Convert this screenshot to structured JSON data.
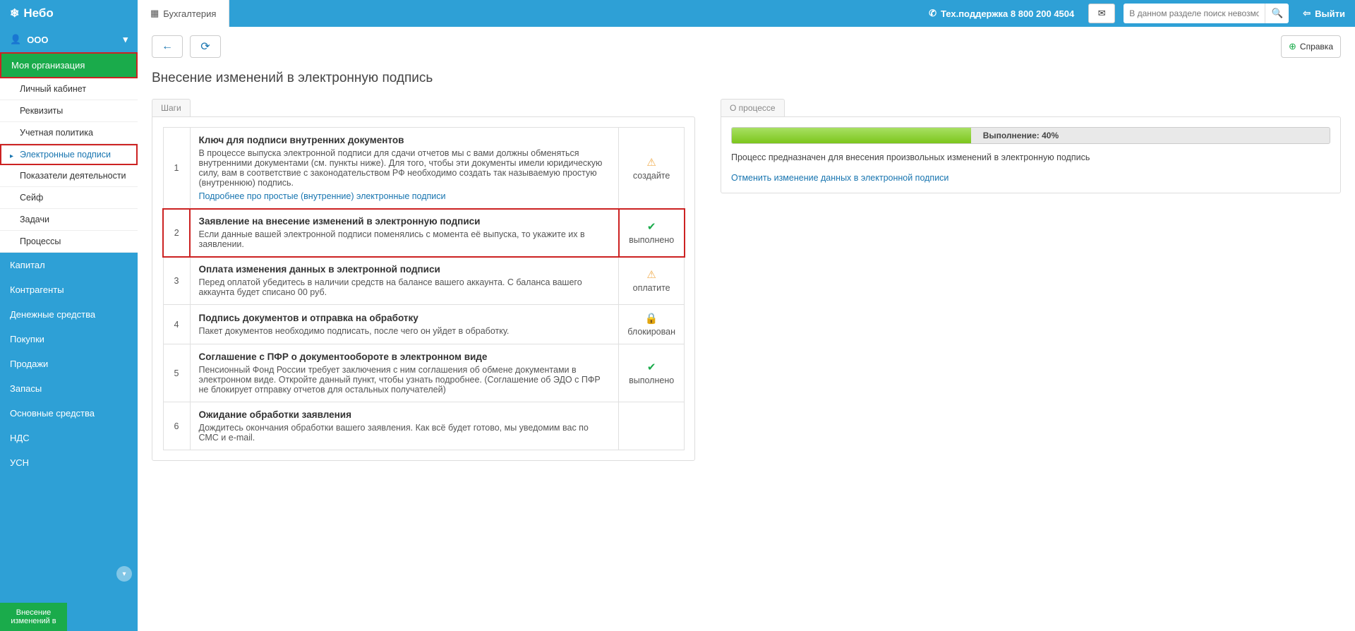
{
  "header": {
    "logo": "Небо",
    "tab": "Бухгалтерия",
    "support_label": "Тех.поддержка 8 800 200 4504",
    "search_placeholder": "В данном разделе поиск невозможен",
    "logout": "Выйти"
  },
  "sidebar": {
    "org": "ООО",
    "section_active": "Моя организация",
    "sub_items": [
      "Личный кабинет",
      "Реквизиты",
      "Учетная политика",
      "Электронные подписи",
      "Показатели деятельности",
      "Сейф",
      "Задачи",
      "Процессы"
    ],
    "main_items": [
      "Капитал",
      "Контрагенты",
      "Денежные средства",
      "Покупки",
      "Продажи",
      "Запасы",
      "Основные средства",
      "НДС",
      "УСН"
    ],
    "bottom_tab": "Внесение изменений в"
  },
  "toolbar": {
    "help": "Справка"
  },
  "page": {
    "title": "Внесение изменений в электронную подпись",
    "steps_tab": "Шаги",
    "process_tab": "О процессе"
  },
  "steps": [
    {
      "num": "1",
      "title": "Ключ для подписи внутренних документов",
      "desc": "В процессе выпуска электронной подписи для сдачи отчетов мы с вами должны обменяться внутренними документами (см. пункты ниже). Для того, чтобы эти документы имели юридическую силу, вам в соответствие с законодательством РФ необходимо создать так называемую простую (внутреннюю) подпись.",
      "link": "Подробнее про простые (внутренние) электронные подписи",
      "status_label": "создайте",
      "status_icon": "warning"
    },
    {
      "num": "2",
      "title": "Заявление на внесение изменений в электронную подписи",
      "desc": "Если данные вашей электронной подписи поменялись с момента её выпуска, то укажите их в заявлении.",
      "status_label": "выполнено",
      "status_icon": "check",
      "highlight": true
    },
    {
      "num": "3",
      "title": "Оплата изменения данных в электронной подписи",
      "desc": "Перед оплатой убедитесь в наличии средств на балансе вашего аккаунта. С баланса вашего аккаунта будет списано  00 руб.",
      "status_label": "оплатите",
      "status_icon": "warning"
    },
    {
      "num": "4",
      "title": "Подпись документов и отправка на обработку",
      "desc": "Пакет документов необходимо подписать, после чего он уйдет в обработку.",
      "status_label": "блокирован",
      "status_icon": "lock"
    },
    {
      "num": "5",
      "title": "Соглашение с ПФР о документообороте в электронном виде",
      "desc": "Пенсионный Фонд России требует заключения с ним соглашения об обмене документами в электронном виде. Откройте данный пункт, чтобы узнать подробнее. (Соглашение об ЭДО с ПФР не блокирует отправку отчетов для остальных получателей)",
      "status_label": "выполнено",
      "status_icon": "check"
    },
    {
      "num": "6",
      "title": "Ожидание обработки заявления",
      "desc": "Дождитесь окончания обработки вашего заявления. Как всё будет готово, мы уведомим вас по СМС и e-mail."
    }
  ],
  "process": {
    "progress_pct": 40,
    "progress_text": "Выполнение: 40%",
    "desc": "Процесс предназначен для внесения произвольных изменений в электронную подпись",
    "cancel_link": "Отменить изменение данных в электронной подписи"
  }
}
